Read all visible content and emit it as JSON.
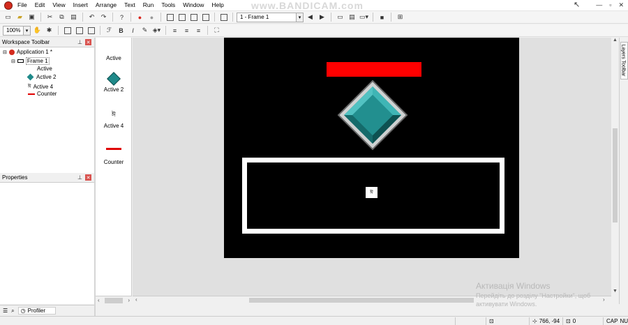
{
  "watermark": {
    "bandicam": "www.BANDICAM.com"
  },
  "menu": [
    "File",
    "Edit",
    "View",
    "Insert",
    "Arrange",
    "Text",
    "Run",
    "Tools",
    "Window",
    "Help"
  ],
  "toolbar": {
    "frame_select": "1 - Frame 1",
    "zoom": "100%"
  },
  "workspace": {
    "title": "Workspace Toolbar",
    "tree": {
      "application": "Application 1 *",
      "frame": "Frame 1",
      "objects": [
        "Active",
        "Active 2",
        "Active 4",
        "Counter"
      ]
    }
  },
  "properties": {
    "title": "Properties"
  },
  "bottom_tabs": {
    "profiler": "Profiler"
  },
  "object_panel": {
    "items": [
      {
        "label": "Active",
        "icon": "blank"
      },
      {
        "label": "Active 2",
        "icon": "teal-diamond-icon"
      },
      {
        "label": "Active 4",
        "icon": "glyph-icon"
      },
      {
        "label": "Counter",
        "icon": "red-line-icon"
      }
    ]
  },
  "layers": {
    "label": "Layers Toolbar"
  },
  "status": {
    "coords": "766, -94",
    "count": "0",
    "caps": "CAP",
    "num": "NUM"
  },
  "windows_watermark": {
    "line1": "Активація Windows",
    "line2": "Перейдіть до розділу \"Настройки\", щоб",
    "line3": "активувати Windows."
  },
  "colors": {
    "frame_bg": "#000000",
    "editor_bg": "#e0e0e0",
    "red_bar": "#ff0000",
    "diamond": "#1f8a8a"
  }
}
